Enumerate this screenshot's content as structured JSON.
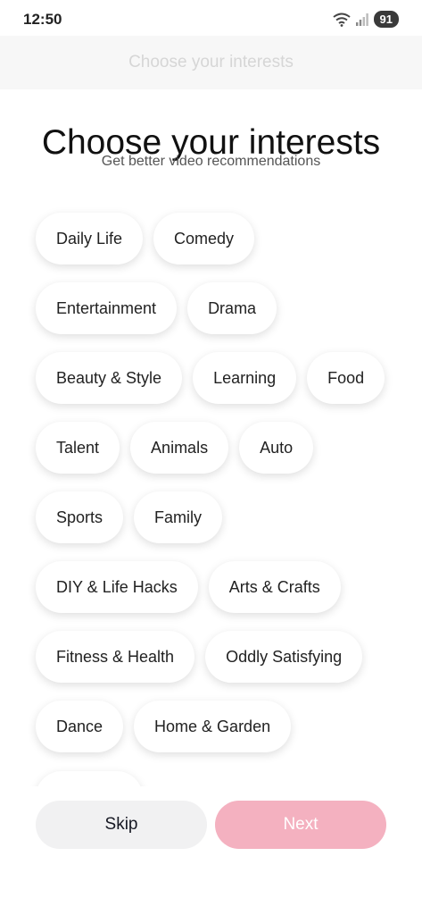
{
  "status_bar": {
    "time": "12:50",
    "battery": "91"
  },
  "top_bar": {
    "title": "Choose your interests"
  },
  "header": {
    "title": "Choose your interests",
    "subtitle": "Get better video recommendations"
  },
  "interests": {
    "rows": [
      [
        "Daily Life",
        "Comedy"
      ],
      [
        "Entertainment",
        "Drama"
      ],
      [
        "Beauty & Style",
        "Learning",
        "Food"
      ],
      [
        "Talent",
        "Animals",
        "Auto"
      ],
      [
        "Sports",
        "Family"
      ],
      [
        "DIY & Life Hacks",
        "Arts & Crafts"
      ],
      [
        "Fitness & Health",
        "Oddly Satisfying"
      ],
      [
        "Dance",
        "Home & Garden"
      ]
    ]
  },
  "actions": {
    "skip_label": "Skip",
    "next_label": "Next"
  },
  "colors": {
    "next_disabled": "#f4b1c0",
    "skip_bg": "#f1f1f2"
  }
}
